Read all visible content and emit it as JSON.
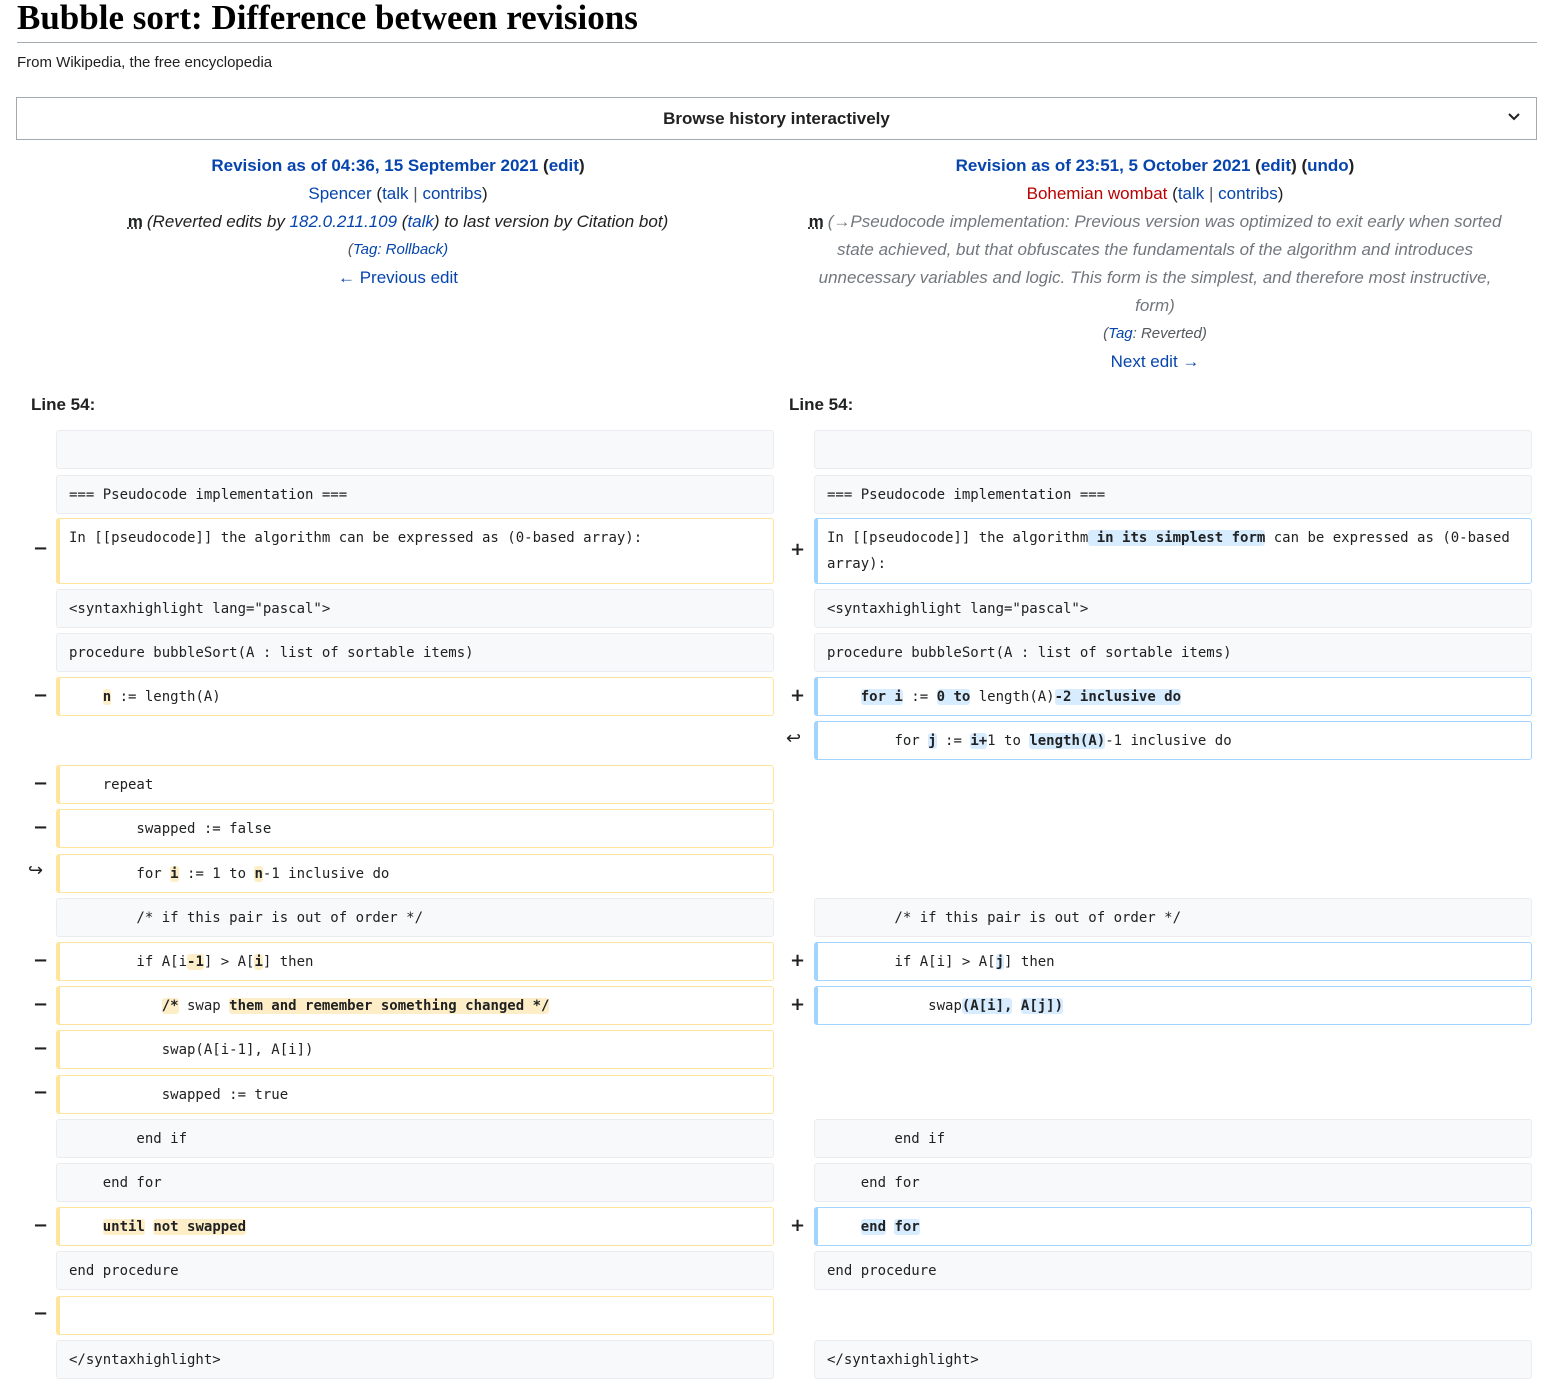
{
  "page": {
    "title": "Bubble sort: Difference between revisions",
    "tagline": "From Wikipedia, the free encyclopedia",
    "browse_label": "Browse history interactively"
  },
  "left_rev": {
    "head_prefix": "Revision as of 04:36, 15 September 2021",
    "edit": "edit",
    "user": "Spencer",
    "talk": "talk",
    "contribs": "contribs",
    "minor": "m",
    "summary_a": "(Reverted edits by ",
    "summary_ip": "182.0.211.109",
    "summary_talk": "talk",
    "summary_b": ") to last version by Citation bot)",
    "tag_prefix": "(",
    "tag_label": "Tag",
    "tag_value": ": Rollback)",
    "nav": "← Previous edit"
  },
  "right_rev": {
    "head_prefix": "Revision as of 23:51, 5 October 2021",
    "edit": "edit",
    "undo": "undo",
    "user": "Bohemian wombat",
    "talk": "talk",
    "contribs": "contribs",
    "minor": "m",
    "summary": "(→Pseudocode implementation: Previous version was optimized to exit early when sorted state achieved, but that obfuscates the fundamentals of the algorithm and introduces unnecessary variables and logic. This form is the simplest, and therefore most instructive, form)",
    "tag_prefix": "(",
    "tag_label": "Tag",
    "tag_value": ": Reverted)",
    "nav": "Next edit →"
  },
  "diff": {
    "left_line_label": "Line 54:",
    "right_line_label": "Line 54:",
    "marks": {
      "minus": "−",
      "plus": "+",
      "moved_out": "↪",
      "moved_in": "↩"
    },
    "ctx": {
      "blank": "",
      "heading": "=== Pseudocode implementation ===",
      "syntax_open": "<syntaxhighlight lang=\"pascal\">",
      "proc": "procedure bubbleSort(A : list of sortable items)",
      "comment": "        /* if this pair is out of order */",
      "end_if": "        end if",
      "end_for": "    end for",
      "end_proc": "end procedure",
      "syntax_close": "</syntaxhighlight>"
    },
    "left": {
      "l3_text": "In [[pseudocode]] the algorithm can be expressed as (0-based array):",
      "l6_pre": "    ",
      "l6_hl": "n",
      "l6_post": " := length(A)",
      "l7": "    repeat",
      "l8": "        swapped := false",
      "l9_a": "        for ",
      "l9_hl1": "i",
      "l9_b": " := 1 to ",
      "l9_hl2": "n",
      "l9_c": "-1 inclusive do",
      "l11_a": "        if A[i",
      "l11_hl1": "-1",
      "l11_b": "] > A[",
      "l11_hl2": "i",
      "l11_c": "] then",
      "l12_pre": "           ",
      "l12_hl1": "/*",
      "l12_mid": " swap ",
      "l12_hl2": "them and remember something changed */",
      "l13": "           swap(A[i-1], A[i])",
      "l14": "           swapped := true",
      "l17_pre": "    ",
      "l17_hl1": "until",
      "l17_sp": " ",
      "l17_hl2": "not swapped"
    },
    "right": {
      "r3_a": "In [[pseudocode]] the algorithm",
      "r3_hl": " in its simplest form",
      "r3_b": " can be expressed as (0-based array):",
      "r6_pre": "    ",
      "r6_hl1": "for i",
      "r6_a": " := ",
      "r6_hl2": "0 to",
      "r6_b": " length(A)",
      "r6_hl3": "-2 inclusive do",
      "r7_a": "        for ",
      "r7_hl1": "j",
      "r7_b": " := ",
      "r7_hl2": "i+",
      "r7_c": "1 to ",
      "r7_hl3": "length(A)",
      "r7_d": "-1 inclusive do",
      "r11_a": "        if A[i] > A[",
      "r11_hl": "j",
      "r11_b": "] then",
      "r12_a": "            swap",
      "r12_hl1": "(A[i],",
      "r12_sp": " ",
      "r12_hl2": "A[j])",
      "r17_pre": "    ",
      "r17_hl1": "end",
      "r17_sp": " ",
      "r17_hl2": "for"
    }
  }
}
